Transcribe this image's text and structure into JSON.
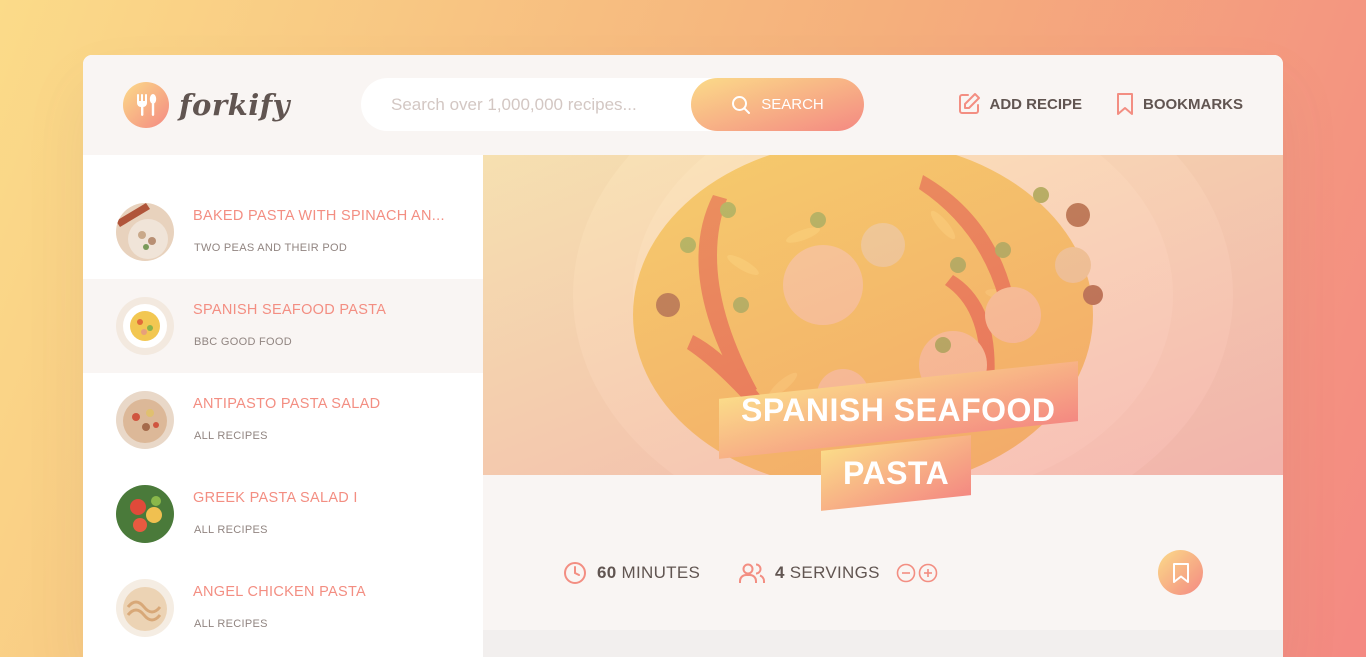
{
  "brand": {
    "name": "forkify",
    "logo_icon": "fork-spoon-icon"
  },
  "search": {
    "placeholder": "Search over 1,000,000 recipes...",
    "value": "",
    "button_label": "SEARCH"
  },
  "nav": {
    "add_recipe": "ADD RECIPE",
    "bookmarks": "BOOKMARKS"
  },
  "results": [
    {
      "title": "BAKED PASTA WITH SPINACH AN...",
      "publisher": "TWO PEAS AND THEIR POD",
      "active": false
    },
    {
      "title": "SPANISH SEAFOOD PASTA",
      "publisher": "BBC GOOD FOOD",
      "active": true
    },
    {
      "title": "ANTIPASTO PASTA SALAD",
      "publisher": "ALL RECIPES",
      "active": false
    },
    {
      "title": "GREEK PASTA SALAD I",
      "publisher": "ALL RECIPES",
      "active": false
    },
    {
      "title": "ANGEL CHICKEN PASTA",
      "publisher": "ALL RECIPES",
      "active": false
    }
  ],
  "recipe": {
    "title_line1": "SPANISH SEAFOOD",
    "title_line2": "PASTA",
    "minutes": "60",
    "minutes_label": "MINUTES",
    "servings": "4",
    "servings_label": "SERVINGS"
  },
  "colors": {
    "accent_start": "#fbdb89",
    "accent_end": "#f48982",
    "title": "#f38e82",
    "text": "#615551"
  }
}
